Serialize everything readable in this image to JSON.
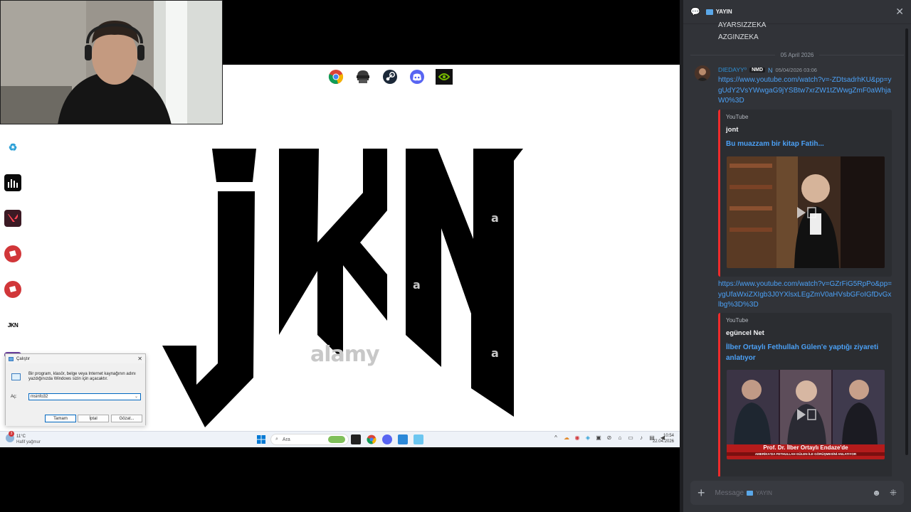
{
  "chat": {
    "channel_name": "YAYIN",
    "previous_lines": [
      "AYARSIZZEKA",
      "AZGINZEKA"
    ],
    "date_divider": "05 April 2026",
    "message": {
      "username": "DIEDAYY⁰",
      "tag": "NMD",
      "timestamp": "05/04/2026 03:06",
      "link1": "https://www.youtube.com/watch?v=-ZDtsadrhKU&pp=ygUdY2VsYWwgaG9jYSBtw7xrZW1tZWwgZmF0aWhjaW0%3D",
      "embed1": {
        "provider": "YouTube",
        "author": "jont",
        "title": "Bu muazzam bir kitap Fatih..."
      },
      "link2": "https://www.youtube.com/watch?v=GZrFiG5RpPo&pp=ygUfaWxiZXIgb3J0YXlsxLEgZmV0aHVsbGFoIGfDvGxlbg%3D%3D",
      "embed2": {
        "provider": "YouTube",
        "author": "egüncel Net",
        "title": "İlber Ortaylı Fethullah Gülen'e yaptığı ziyareti anlatıyor",
        "thumb_caption1": "Prof. Dr. İlber Ortaylı Endaze'de",
        "thumb_caption2": "AMERİKA'DA FETHULLAH GÜLEN İLE GÖRÜŞMESİNİ ANLATIYOR"
      }
    },
    "composer_placeholder": "Message",
    "composer_channel": "YAYIN"
  },
  "desktop": {
    "toolbar_apps": [
      "chrome-icon",
      "pubg-icon",
      "steam-icon",
      "discord-icon",
      "nvidia-icon"
    ],
    "wallpaper_text": "JKN",
    "watermarks": [
      "a",
      "a",
      "alamy",
      "a"
    ],
    "shortcut_label_jkn": "JKN"
  },
  "run_dialog": {
    "title": "Çalıştır",
    "description": "Bir program, klasör, belge veya Internet kaynağının adını yazdığınızda Windows sizin için açacaktır.",
    "open_label": "Aç:",
    "input_value": "msinfo32",
    "ok_label": "Tamam",
    "cancel_label": "İptal",
    "browse_label": "Gözat..."
  },
  "taskbar": {
    "weather_badge": "3",
    "weather_temp": "11°C",
    "weather_desc": "Hafif yağmur",
    "search_placeholder": "Ara",
    "time": "10:54",
    "date": "22.04.2026"
  },
  "colors": {
    "chat_bg": "#313338",
    "link": "#4ba0f5",
    "embed_border": "#ee2b2b",
    "username": "#2d8fd5",
    "taskbar_bg": "#eef2f8"
  }
}
